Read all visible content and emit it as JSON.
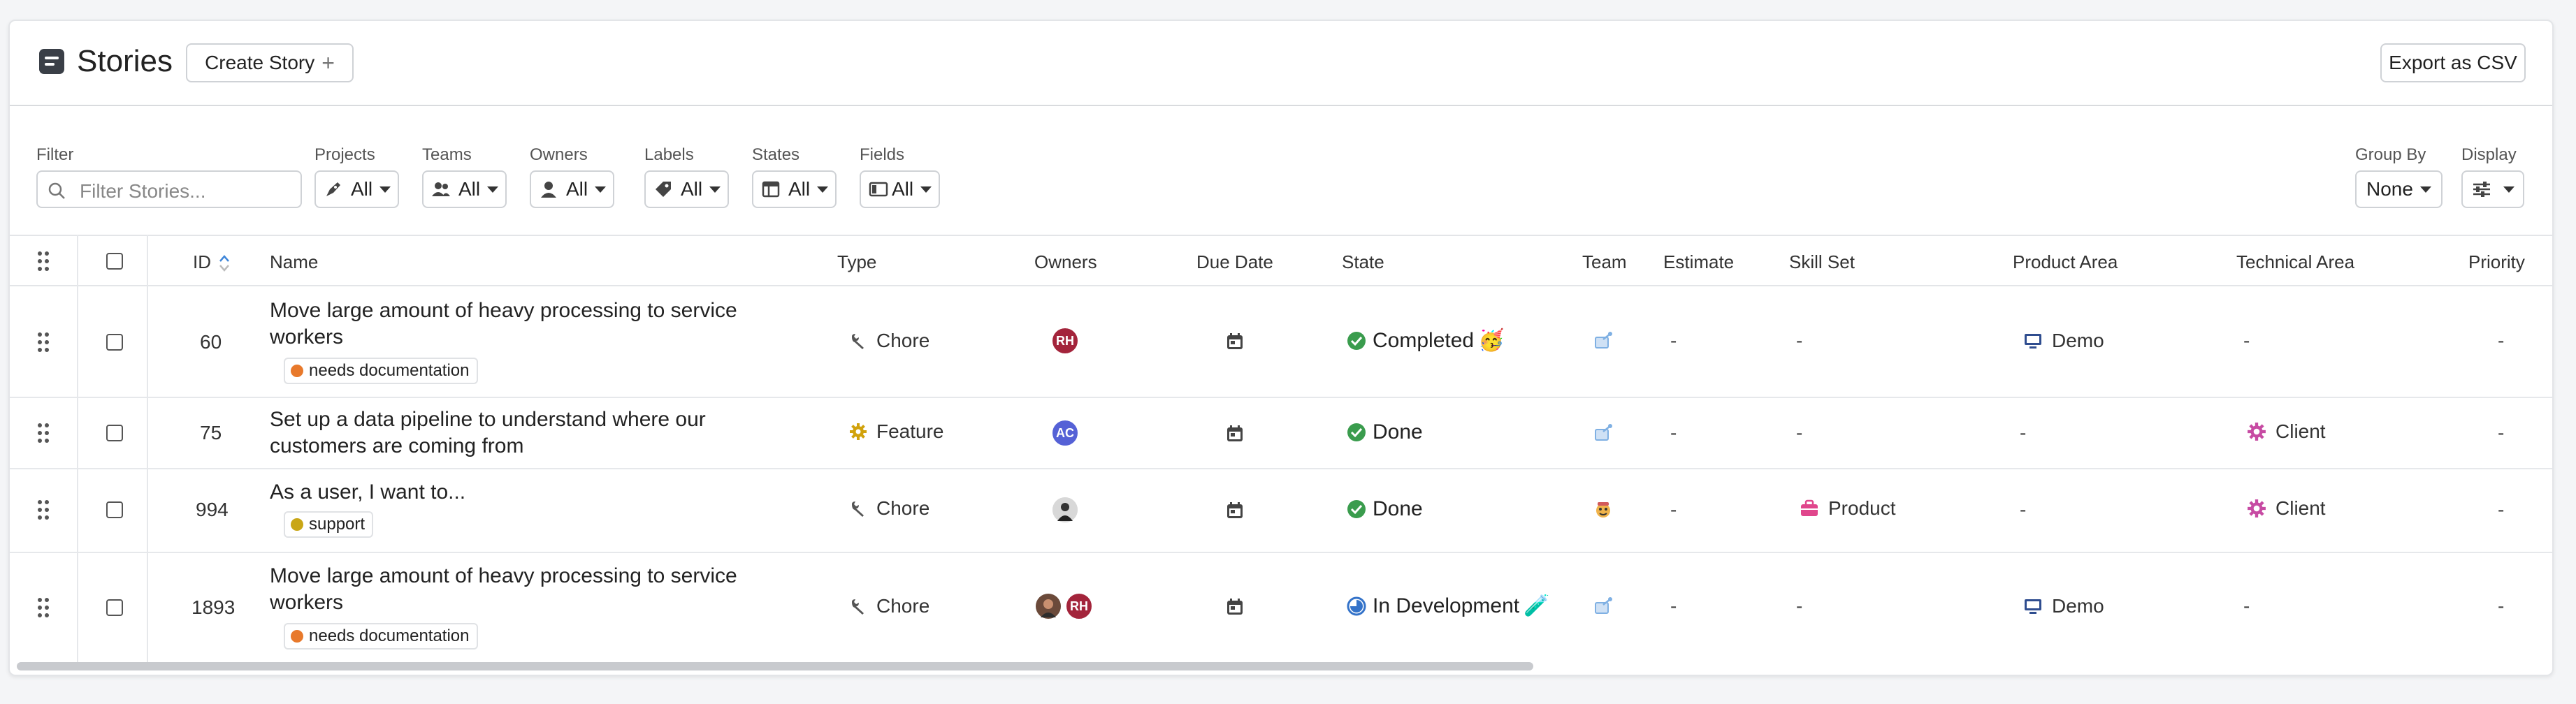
{
  "header": {
    "title": "Stories",
    "create_label": "Create Story",
    "export_label": "Export as CSV"
  },
  "filters": {
    "filter_label": "Filter",
    "search_placeholder": "Filter Stories...",
    "projects": {
      "label": "Projects",
      "value": "All"
    },
    "teams": {
      "label": "Teams",
      "value": "All"
    },
    "owners": {
      "label": "Owners",
      "value": "All"
    },
    "labels": {
      "label": "Labels",
      "value": "All"
    },
    "states": {
      "label": "States",
      "value": "All"
    },
    "fields": {
      "label": "Fields",
      "value": "All"
    },
    "group_by": {
      "label": "Group By",
      "value": "None"
    },
    "display": {
      "label": "Display"
    }
  },
  "columns": [
    "ID",
    "Name",
    "Type",
    "Owners",
    "Due Date",
    "State",
    "Team",
    "Estimate",
    "Skill Set",
    "Product Area",
    "Technical Area",
    "Priority"
  ],
  "rows": [
    {
      "id": "60",
      "name": "Move large amount of heavy processing to service workers",
      "label": "needs documentation",
      "label_color": "#e8792b",
      "type": "Chore",
      "owners": [
        "RH"
      ],
      "state": "Completed",
      "state_emoji": "🥳",
      "estimate": "-",
      "skill_set": "-",
      "product_area": "Demo",
      "technical_area": "-",
      "priority": "-"
    },
    {
      "id": "75",
      "name": "Set up a data pipeline to understand where our customers are coming from",
      "label": "",
      "type": "Feature",
      "owners": [
        "AC"
      ],
      "state": "Done",
      "estimate": "-",
      "skill_set": "-",
      "product_area": "-",
      "technical_area": "Client",
      "priority": "-"
    },
    {
      "id": "994",
      "name": "As a user, I want to...",
      "label": "support",
      "label_color": "#c9a615",
      "type": "Chore",
      "owners": [
        "photo"
      ],
      "state": "Done",
      "estimate": "-",
      "skill_set": "Product",
      "product_area": "-",
      "technical_area": "Client",
      "priority": "-"
    },
    {
      "id": "1893",
      "name": "Move large amount of heavy processing to service workers",
      "label": "needs documentation",
      "label_color": "#e8792b",
      "type": "Chore",
      "owners": [
        "photo",
        "RH"
      ],
      "state": "In Development",
      "state_emoji": "🧪",
      "estimate": "-",
      "skill_set": "-",
      "product_area": "Demo",
      "technical_area": "-",
      "priority": "-"
    }
  ],
  "colors": {
    "done": "#3a9c4d",
    "accent": "#4d64c9",
    "owner_rh": "#a3243b",
    "owner_ac": "#5561d6",
    "area_client": "#c74ba3",
    "area_demo": "#2f4d8f"
  }
}
